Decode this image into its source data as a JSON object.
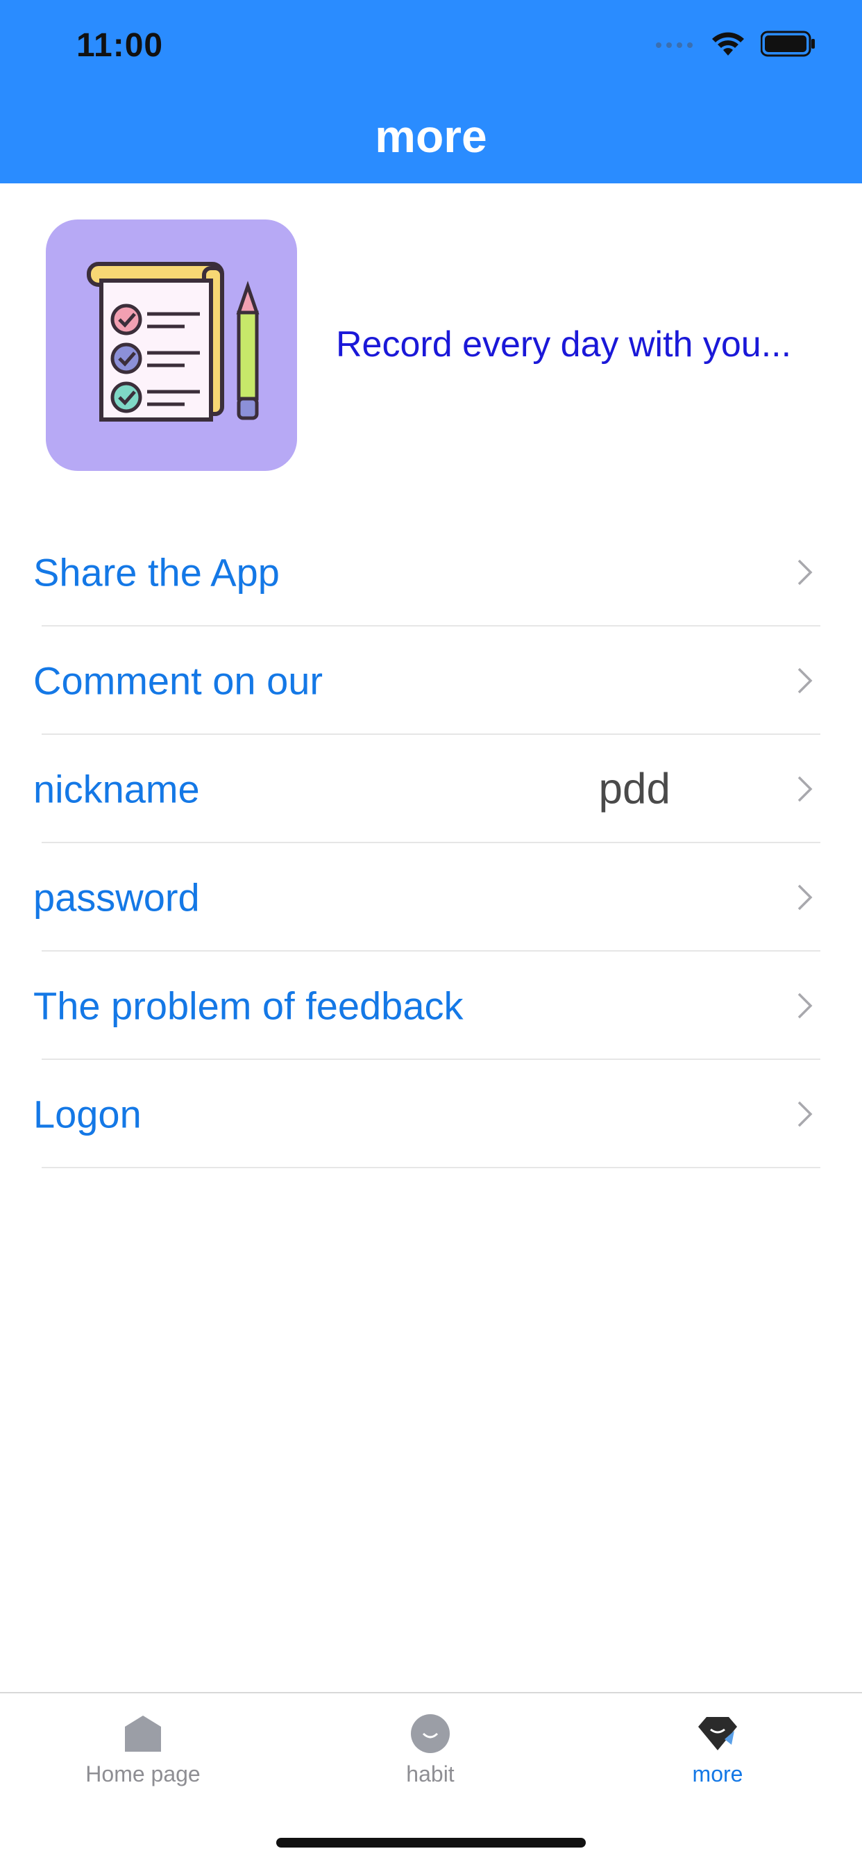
{
  "status_bar": {
    "time": "11:00"
  },
  "nav": {
    "title": "more"
  },
  "profile": {
    "slogan": "Record every day with you...",
    "icon": "checklist-notepad-pencil-icon"
  },
  "menu": [
    {
      "label": "Share the App",
      "value": ""
    },
    {
      "label": "Comment on our",
      "value": ""
    },
    {
      "label": "nickname",
      "value": "pdd"
    },
    {
      "label": "password",
      "value": ""
    },
    {
      "label": "The problem of feedback",
      "value": ""
    },
    {
      "label": "Logon",
      "value": ""
    }
  ],
  "tabs": [
    {
      "label": "Home page",
      "icon": "home-icon",
      "active": false
    },
    {
      "label": "habit",
      "icon": "smile-icon",
      "active": false
    },
    {
      "label": "more",
      "icon": "diamond-smile-icon",
      "active": true
    }
  ],
  "colors": {
    "header": "#2a8cff",
    "accent": "#1478e6",
    "slogan": "#1a18d8",
    "inactive_tab": "#8e8e93",
    "icon_bg": "#b7a9f5"
  }
}
